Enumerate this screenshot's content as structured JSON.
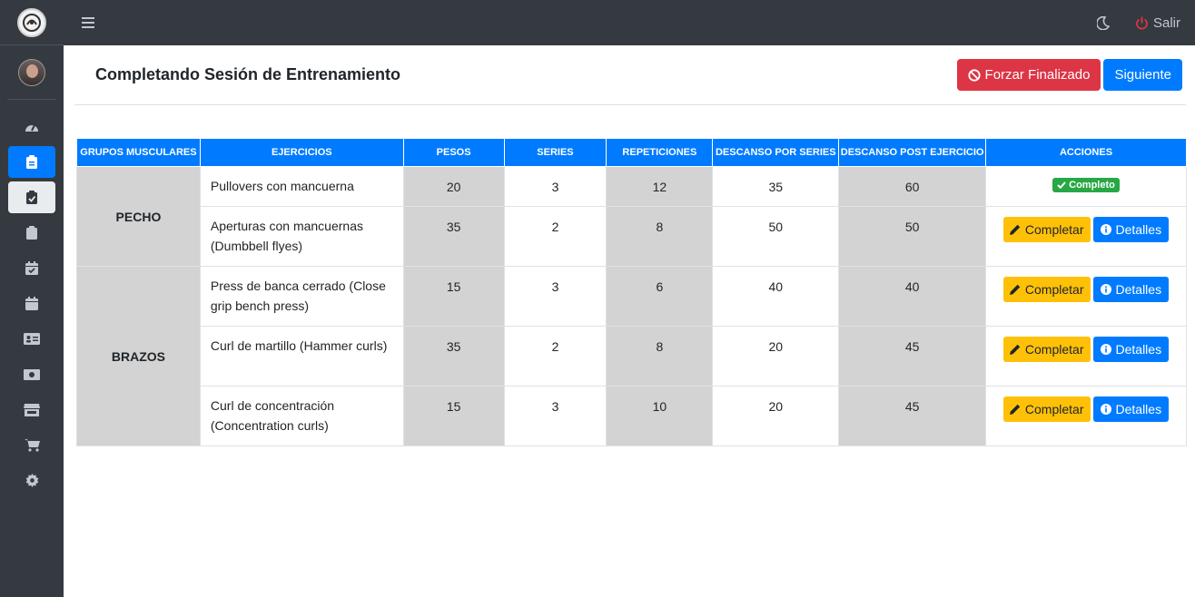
{
  "topbar": {
    "logout_label": "Salir"
  },
  "page": {
    "title": "Completando Sesión de Entrenamiento",
    "force_label": "Forzar Finalizado",
    "next_label": "Siguiente"
  },
  "sidebar": {
    "items": [
      {
        "icon": "dashboard-icon"
      },
      {
        "icon": "clipboard-list-icon",
        "state": "active"
      },
      {
        "icon": "clipboard-check-icon",
        "state": "hover"
      },
      {
        "icon": "clipboard-icon"
      },
      {
        "icon": "calendar-check-icon"
      },
      {
        "icon": "calendar-icon"
      },
      {
        "icon": "id-card-icon"
      },
      {
        "icon": "money-bill-icon"
      },
      {
        "icon": "store-icon"
      },
      {
        "icon": "cart-icon"
      },
      {
        "icon": "gear-icon"
      }
    ]
  },
  "table": {
    "headers": [
      "GRUPOS MUSCULARES",
      "EJERCICIOS",
      "PESOS",
      "SERIES",
      "REPETICIONES",
      "DESCANSO POR SERIES",
      "DESCANSO POST EJERCICIO",
      "ACCIONES"
    ],
    "groups": [
      {
        "name": "PECHO"
      },
      {
        "name": "BRAZOS"
      }
    ],
    "rows": [
      {
        "exercise": "Pullovers con mancuerna",
        "weight": "20",
        "series": "3",
        "reps": "12",
        "rest_series": "35",
        "rest_post": "60",
        "status": "Completo"
      },
      {
        "exercise": "Aperturas con mancuernas (Dumbbell flyes)",
        "weight": "35",
        "series": "2",
        "reps": "8",
        "rest_series": "50",
        "rest_post": "50"
      },
      {
        "exercise": "Press de banca cerrado (Close grip bench press)",
        "weight": "15",
        "series": "3",
        "reps": "6",
        "rest_series": "40",
        "rest_post": "40"
      },
      {
        "exercise": "Curl de martillo (Hammer curls)",
        "weight": "35",
        "series": "2",
        "reps": "8",
        "rest_series": "20",
        "rest_post": "45"
      },
      {
        "exercise": "Curl de concentración (Concentration curls)",
        "weight": "15",
        "series": "3",
        "reps": "10",
        "rest_series": "20",
        "rest_post": "45"
      }
    ],
    "complete_label": "Completar",
    "details_label": "Detalles"
  },
  "colors": {
    "primary": "#007bff",
    "danger": "#dc3545",
    "warning": "#ffc107",
    "success": "#28a745",
    "sidebar": "#343a40"
  }
}
